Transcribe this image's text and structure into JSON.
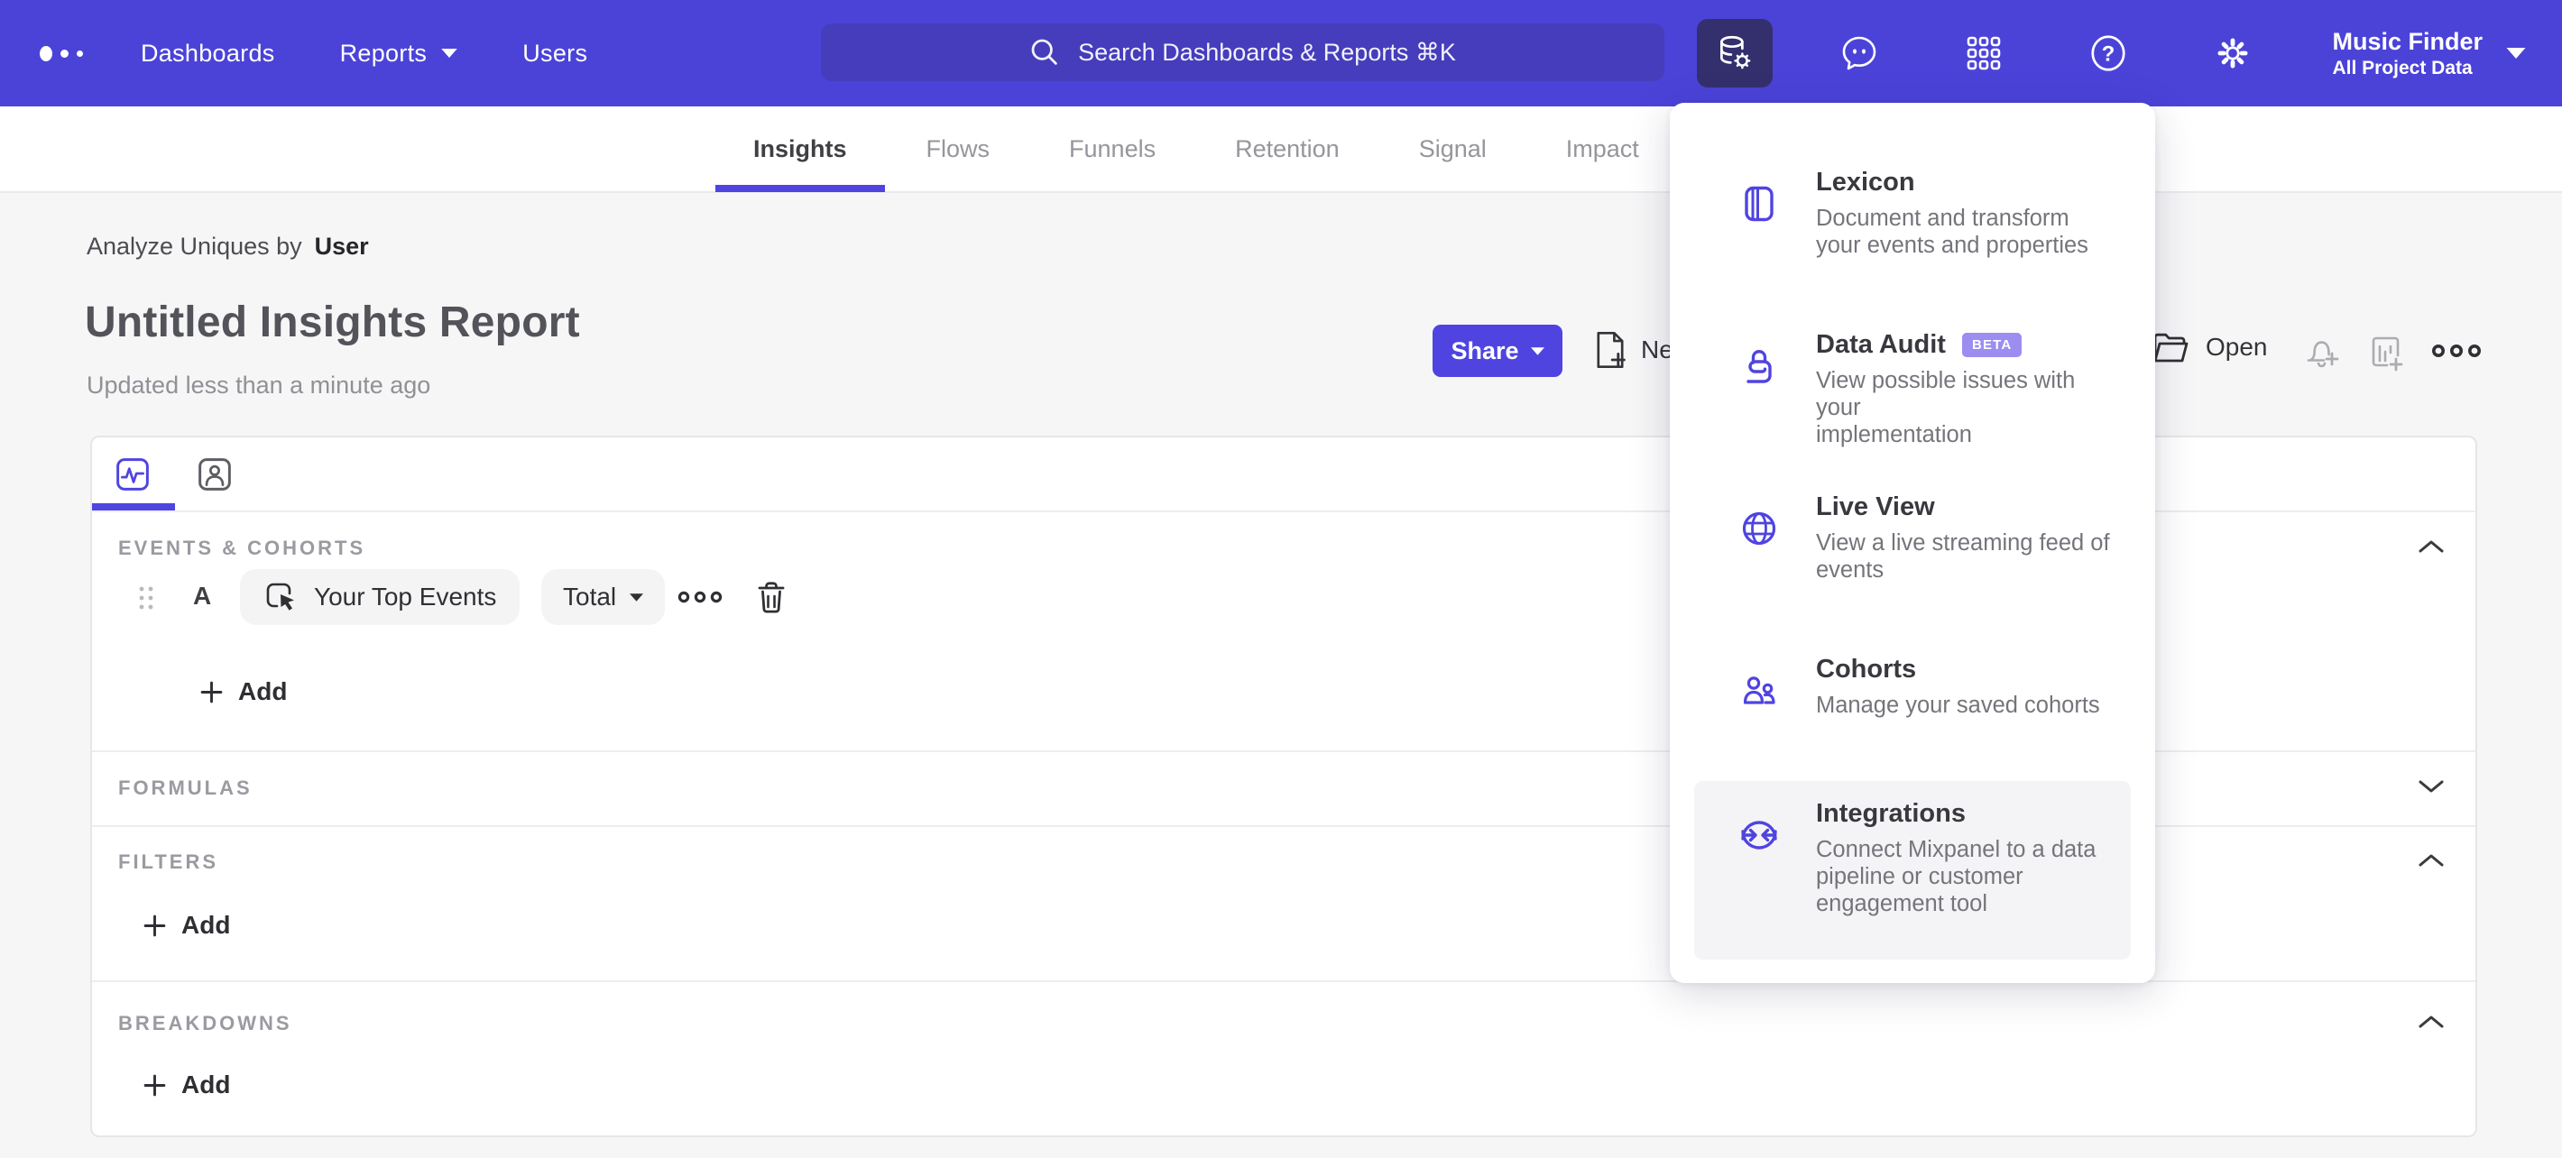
{
  "topnav": {
    "nav_items": {
      "dashboards": "Dashboards",
      "reports": "Reports",
      "users": "Users"
    },
    "search": {
      "placeholder": "Search Dashboards & Reports ⌘K"
    },
    "project": {
      "name": "Music Finder",
      "scope": "All Project Data"
    }
  },
  "report_tabs": [
    {
      "label": "Insights"
    },
    {
      "label": "Flows"
    },
    {
      "label": "Funnels"
    },
    {
      "label": "Retention"
    },
    {
      "label": "Signal"
    },
    {
      "label": "Impact"
    }
  ],
  "header": {
    "context_label": "Analyze Uniques by",
    "context_value": "User",
    "title": "Untitled Insights Report",
    "updated": "Updated less than a minute ago",
    "share_label": "Share",
    "new_label": "Ne",
    "open_label": "Open"
  },
  "builder": {
    "events": {
      "label": "EVENTS & COHORTS",
      "row": {
        "letter": "A",
        "event": "Your Top Events",
        "metric": "Total"
      },
      "add_label": "Add"
    },
    "formulas": {
      "label": "FORMULAS"
    },
    "filters": {
      "label": "FILTERS",
      "add_label": "Add"
    },
    "breakdowns": {
      "label": "BREAKDOWNS",
      "add_label": "Add"
    }
  },
  "data_menu": {
    "items": [
      {
        "title": "Lexicon",
        "description": "Document and transform\nyour events and properties"
      },
      {
        "title": "Data Audit",
        "badge": "BETA",
        "description": "View possible issues with your\nimplementation"
      },
      {
        "title": "Live View",
        "description": "View a live streaming feed of\nevents"
      },
      {
        "title": "Cohorts",
        "description": "Manage your saved cohorts"
      },
      {
        "title": "Integrations",
        "description": "Connect Mixpanel to a data\npipeline or customer\nengagement tool"
      }
    ]
  },
  "colors": {
    "accent": "#4F44E0",
    "nav_bg": "#4B43D8",
    "nav_active_bg": "#34306E",
    "beta_badge": "#9C8DF1"
  }
}
